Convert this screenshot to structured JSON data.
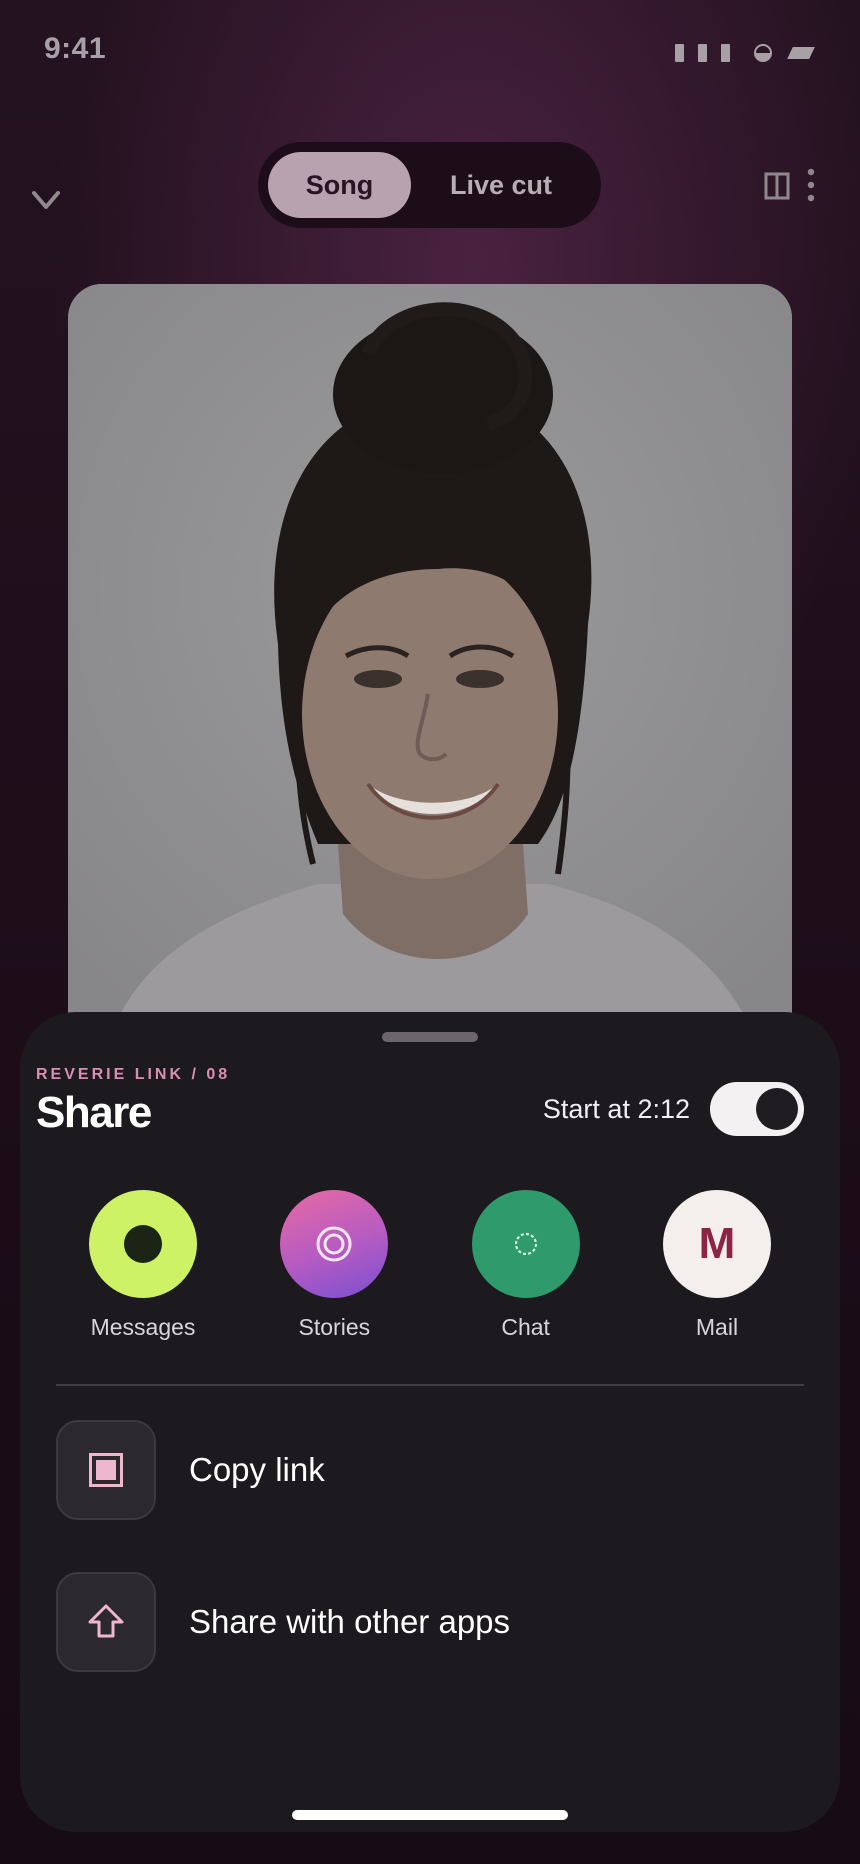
{
  "status_bar": {
    "time": "9:41",
    "icons": [
      "signal-icon",
      "battery-icon",
      "wifi-icon"
    ]
  },
  "header": {
    "collapse_icon": "chevron-down-icon",
    "segments": [
      {
        "label": "Song",
        "selected": true
      },
      {
        "label": "Live cut",
        "selected": false
      }
    ],
    "right_icons": [
      "split-view-icon",
      "more-vertical-icon"
    ]
  },
  "artwork": {
    "description_icon": "album-artwork-portrait"
  },
  "share_sheet": {
    "eyebrow": "REVERIE LINK / 08",
    "title": "Share",
    "start_at": {
      "label": "Start at 2:12",
      "enabled": true
    },
    "targets": [
      {
        "label": "Messages",
        "icon": "messages-icon",
        "color": "#cdf266"
      },
      {
        "label": "Stories",
        "icon": "stories-icon",
        "color": "#b45bc3"
      },
      {
        "label": "Chat",
        "icon": "chat-icon",
        "color": "#2f9a6c"
      },
      {
        "label": "Mail",
        "icon": "mail-icon",
        "glyph": "M",
        "color": "#f4efed"
      }
    ],
    "actions": [
      {
        "label": "Copy link",
        "icon": "copy-link-icon"
      },
      {
        "label": "Share with other apps",
        "icon": "share-upload-icon"
      }
    ]
  },
  "colors": {
    "accent": "#d88fb3",
    "sheet_background": "#1c1a1f",
    "segment_active": "#b8a2b0"
  }
}
